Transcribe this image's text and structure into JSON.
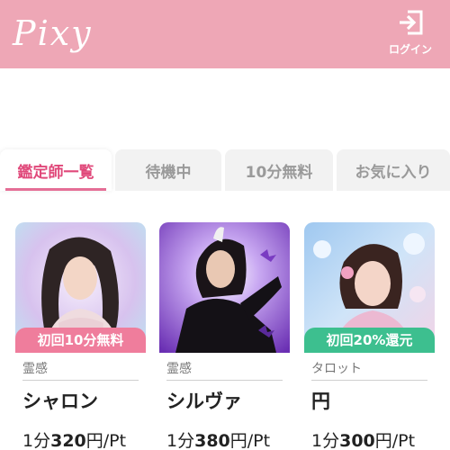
{
  "header": {
    "logo": "Pixy",
    "login_label": "ログイン",
    "brand_color": "#eea7b6"
  },
  "tabs": [
    {
      "label": "鑑定師一覧",
      "active": true
    },
    {
      "label": "待機中",
      "active": false
    },
    {
      "label": "10分無料",
      "active": false
    },
    {
      "label": "お気に入り",
      "active": false
    }
  ],
  "advisors": [
    {
      "badge": "初回10分無料",
      "badge_color": "#ef7d9c",
      "category": "霊感",
      "name": "シャロン",
      "price_prefix": "1分",
      "price_value": "320",
      "price_suffix": "円/Pt"
    },
    {
      "badge": "",
      "badge_color": "",
      "category": "霊感",
      "name": "シルヴァ",
      "price_prefix": "1分",
      "price_value": "380",
      "price_suffix": "円/Pt"
    },
    {
      "badge": "初回20%還元",
      "badge_color": "#3dbf8f",
      "category": "タロット",
      "name": "円",
      "price_prefix": "1分",
      "price_value": "300",
      "price_suffix": "円/Pt"
    }
  ]
}
